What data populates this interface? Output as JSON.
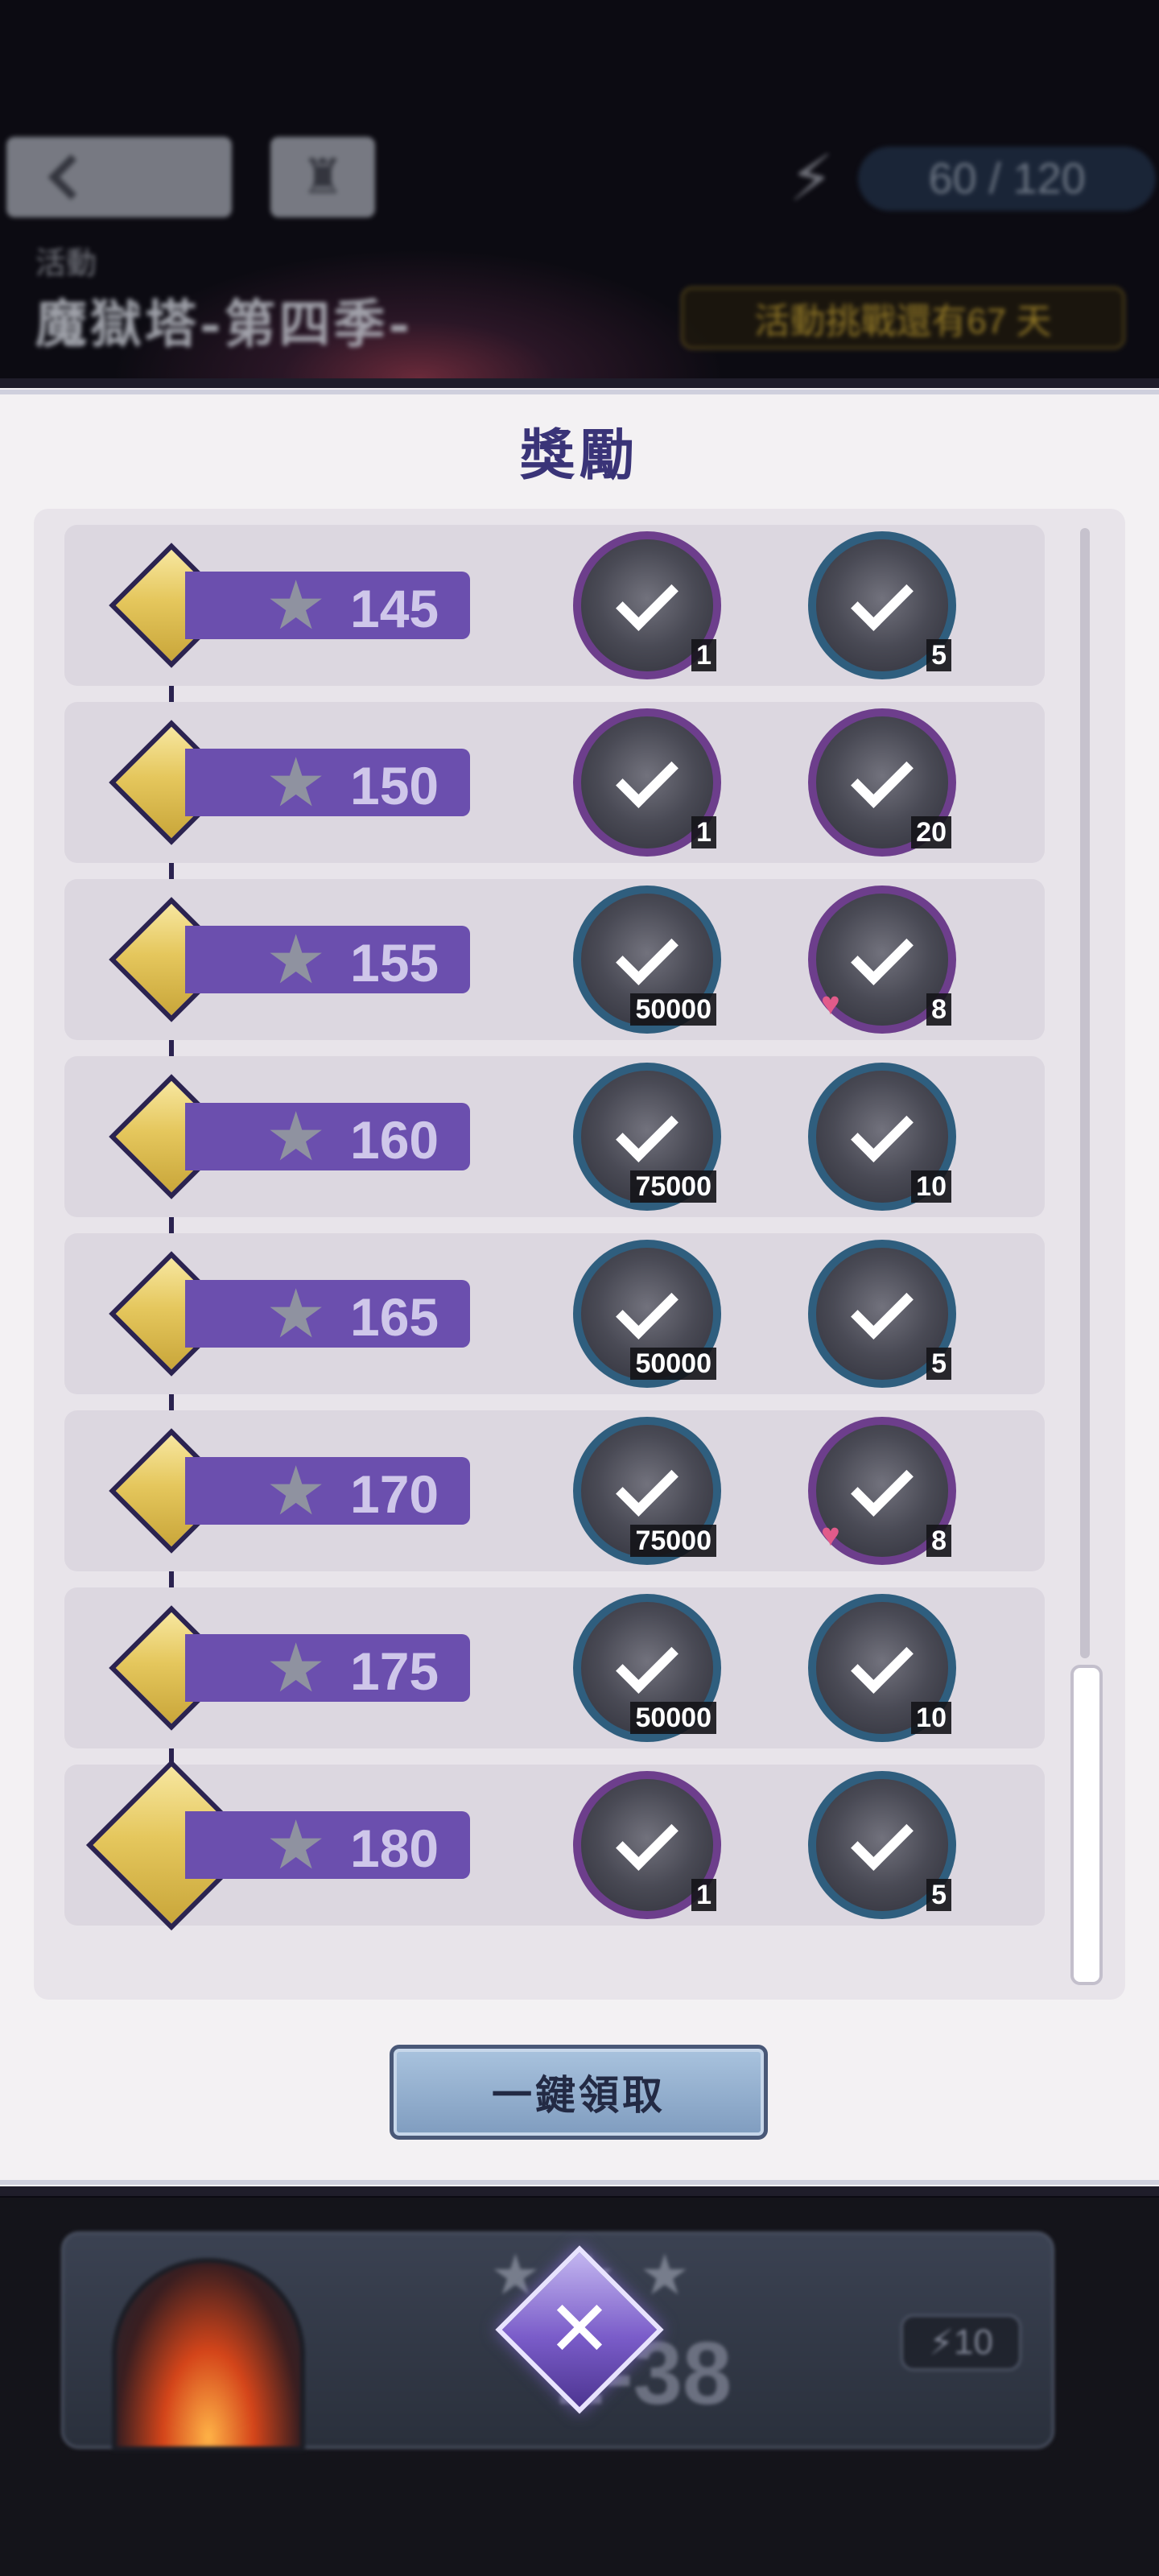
{
  "header": {
    "energy": "60 / 120",
    "event_caption": "活動",
    "event_title": "魔獄塔-第四季-",
    "countdown": "活動挑戰還有67 天"
  },
  "modal": {
    "title": "獎勵",
    "claim_all_label": "一鍵領取"
  },
  "tiers": [
    {
      "stars": "145",
      "rewards": [
        {
          "icon": "ore-icon",
          "qty": "1",
          "ring": "purple"
        },
        {
          "icon": "card-icon",
          "qty": "5",
          "ring": "blue"
        }
      ]
    },
    {
      "stars": "150",
      "rewards": [
        {
          "icon": "wisp-icon",
          "qty": "1",
          "ring": "purple"
        },
        {
          "icon": "potion-icon",
          "qty": "20",
          "ring": "purple"
        }
      ]
    },
    {
      "stars": "155",
      "rewards": [
        {
          "icon": "coin-icon",
          "qty": "50000",
          "ring": "blue"
        },
        {
          "icon": "fruit-icon",
          "qty": "8",
          "ring": "purple"
        }
      ]
    },
    {
      "stars": "160",
      "rewards": [
        {
          "icon": "coin-icon",
          "qty": "75000",
          "ring": "blue"
        },
        {
          "icon": "ticket-icon",
          "qty": "10",
          "ring": "blue"
        }
      ]
    },
    {
      "stars": "165",
      "rewards": [
        {
          "icon": "coin-icon",
          "qty": "50000",
          "ring": "blue"
        },
        {
          "icon": "card-icon",
          "qty": "5",
          "ring": "blue"
        }
      ]
    },
    {
      "stars": "170",
      "rewards": [
        {
          "icon": "coin-icon",
          "qty": "75000",
          "ring": "blue"
        },
        {
          "icon": "fruit-icon",
          "qty": "8",
          "ring": "purple"
        }
      ]
    },
    {
      "stars": "175",
      "rewards": [
        {
          "icon": "coin-icon",
          "qty": "50000",
          "ring": "blue"
        },
        {
          "icon": "ticket-icon",
          "qty": "10",
          "ring": "blue"
        }
      ]
    },
    {
      "stars": "180",
      "rewards": [
        {
          "icon": "ore-icon",
          "qty": "1",
          "ring": "purple"
        },
        {
          "icon": "card-icon",
          "qty": "5",
          "ring": "blue"
        }
      ]
    }
  ],
  "footer": {
    "stage": "1-38",
    "cost": "10"
  }
}
